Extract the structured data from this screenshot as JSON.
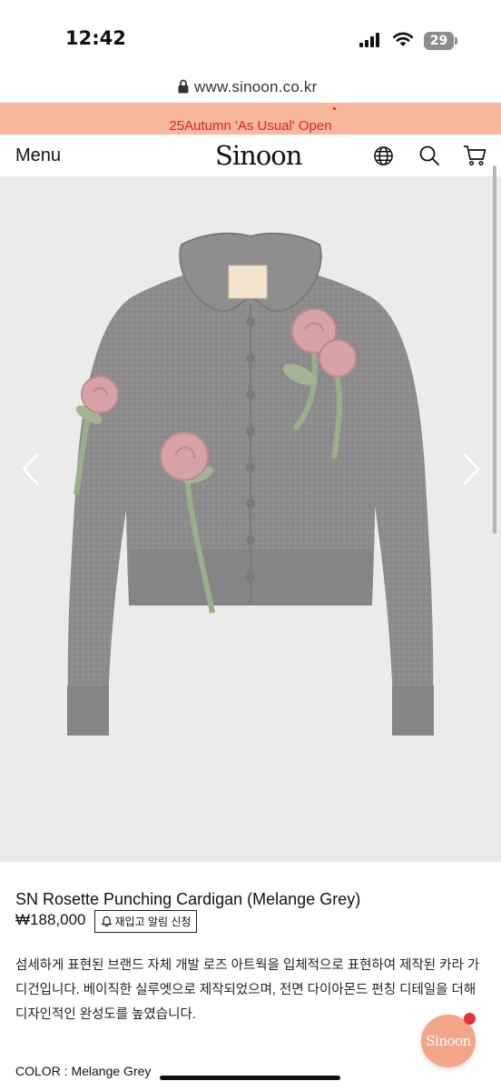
{
  "status_bar": {
    "time": "12:42",
    "battery": "29",
    "icons": [
      "signal-icon",
      "wifi-icon",
      "battery-icon"
    ]
  },
  "browser": {
    "url": "www.sinoon.co.kr",
    "icon": "lock-icon"
  },
  "promo": {
    "text": "25Autumn 'As Usual' Open",
    "background": "#f8b89c",
    "text_color": "#d8232a"
  },
  "header": {
    "menu_label": "Menu",
    "logo": "Sinoon",
    "icons": [
      "globe-icon",
      "search-icon",
      "cart-icon"
    ]
  },
  "gallery": {
    "image": "grey knit cardigan with pink rose appliqués",
    "icons": [
      "chevron-left-icon",
      "chevron-right-icon"
    ]
  },
  "product": {
    "title": "SN Rosette Punching Cardigan (Melange Grey)",
    "price": "₩188,000",
    "restock_button": "재입고 알림 신청",
    "description": "섬세하게 표현된 브랜드 자체 개발 로즈 아트웍을 입체적으로 표현하여 제작된 카라 가디건입니다. 베이직한 실루엣으로 제작되었으며, 전면 다이아몬드 펀칭 디테일을 더해 디자인적인 완성도를 높였습니다.",
    "color_line": "COLOR : Melange Grey"
  },
  "chat": {
    "label": "Sinoon",
    "color": "#f3a587",
    "badge_color": "#e8323a"
  }
}
